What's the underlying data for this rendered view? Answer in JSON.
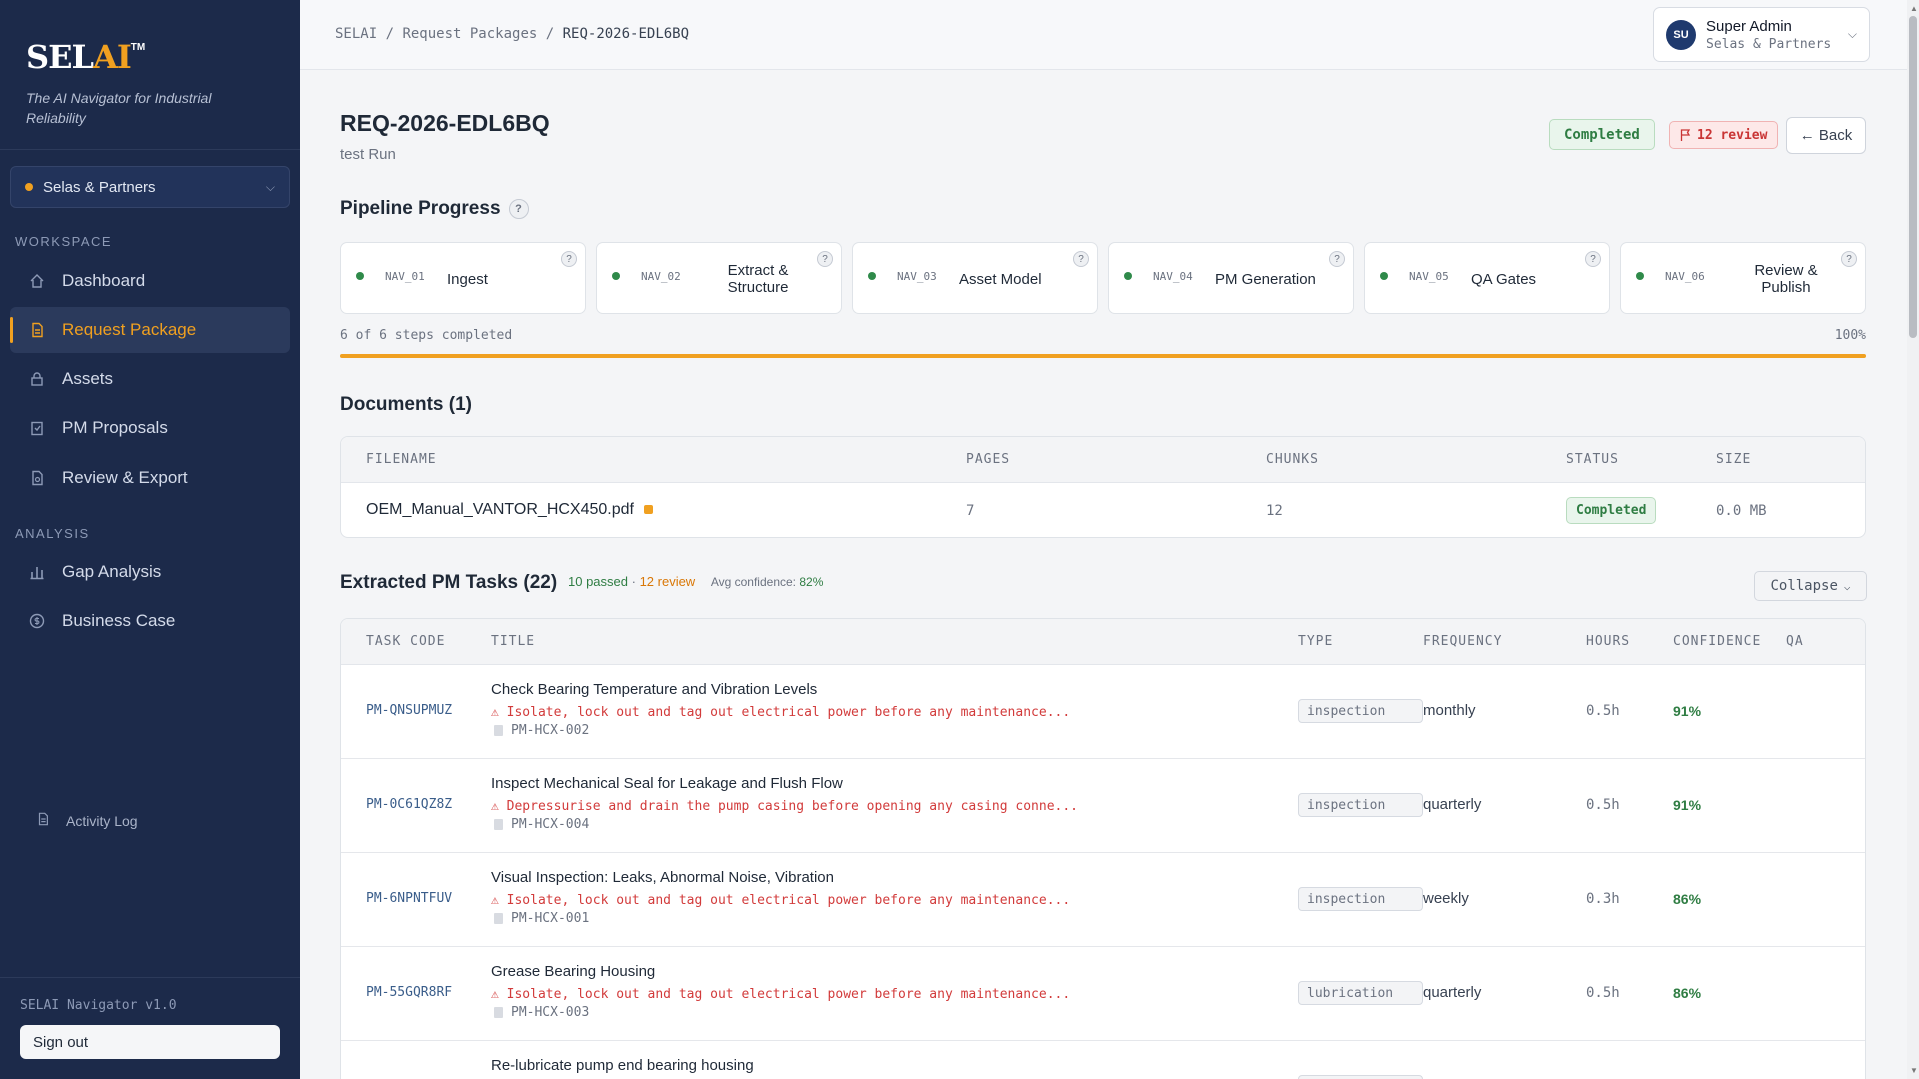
{
  "sidebar": {
    "logo_main": "SEL",
    "logo_accent": "AI",
    "logo_tm": "TM",
    "tagline": "The AI Navigator for Industrial Reliability",
    "org": "Selas & Partners",
    "workspace_label": "WORKSPACE",
    "analysis_label": "ANALYSIS",
    "items": [
      {
        "label": "Dashboard",
        "icon": "home-icon"
      },
      {
        "label": "Request Package",
        "icon": "document-icon"
      },
      {
        "label": "Assets",
        "icon": "lock-icon"
      },
      {
        "label": "PM Proposals",
        "icon": "clipboard-icon"
      },
      {
        "label": "Review & Export",
        "icon": "document-check-icon"
      },
      {
        "label": "Gap Analysis",
        "icon": "bar-chart-icon"
      },
      {
        "label": "Business Case",
        "icon": "dollar-icon"
      }
    ],
    "activity_log": "Activity Log",
    "version": "SELAI Navigator v1.0",
    "sign_out": "Sign out"
  },
  "topbar": {
    "breadcrumb": [
      "SELAI",
      "Request Packages",
      "REQ-2026-EDL6BQ"
    ],
    "user_initials": "SU",
    "user_name": "Super Admin",
    "user_org": "Selas & Partners"
  },
  "header": {
    "title": "REQ-2026-EDL6BQ",
    "subtitle": "test Run",
    "status": "Completed",
    "review_badge": "12 review",
    "back_label": "← Back"
  },
  "pipeline": {
    "title": "Pipeline Progress",
    "steps": [
      {
        "code": "NAV_01",
        "name": "Ingest"
      },
      {
        "code": "NAV_02",
        "name": "Extract & Structure"
      },
      {
        "code": "NAV_03",
        "name": "Asset Model"
      },
      {
        "code": "NAV_04",
        "name": "PM Generation"
      },
      {
        "code": "NAV_05",
        "name": "QA Gates"
      },
      {
        "code": "NAV_06",
        "name": "Review & Publish"
      }
    ],
    "progress_text": "6 of 6 steps completed",
    "progress_pct_label": "100%",
    "progress_fraction": 1.0
  },
  "documents": {
    "title": "Documents (1)",
    "columns": [
      "FILENAME",
      "PAGES",
      "CHUNKS",
      "STATUS",
      "SIZE"
    ],
    "rows": [
      {
        "filename": "OEM_Manual_VANTOR_HCX450.pdf",
        "pages": "7",
        "chunks": "12",
        "status": "Completed",
        "size": "0.0 MB"
      }
    ]
  },
  "tasks": {
    "title": "Extracted PM Tasks (22)",
    "passed": "10 passed",
    "sep": " · ",
    "review": "12 review",
    "avg_label": "Avg confidence: ",
    "avg_value": "82%",
    "collapse_label": "Collapse",
    "columns": [
      "TASK CODE",
      "TITLE",
      "TYPE",
      "FREQUENCY",
      "HOURS",
      "CONFIDENCE",
      "QA"
    ],
    "rows": [
      {
        "code": "PM-QNSUPMUZ",
        "title": "Check Bearing Temperature and Vibration Levels",
        "warning": "⚠ Isolate, lock out and tag out electrical power before any maintenance...",
        "ref": "PM-HCX-002",
        "type": "inspection",
        "frequency": "monthly",
        "hours": "0.5h",
        "confidence": "91%"
      },
      {
        "code": "PM-0C61QZ8Z",
        "title": "Inspect Mechanical Seal for Leakage and Flush Flow",
        "warning": "⚠ Depressurise and drain the pump casing before opening any casing conne...",
        "ref": "PM-HCX-004",
        "type": "inspection",
        "frequency": "quarterly",
        "hours": "0.5h",
        "confidence": "91%"
      },
      {
        "code": "PM-6NPNTFUV",
        "title": "Visual Inspection: Leaks, Abnormal Noise, Vibration",
        "warning": "⚠ Isolate, lock out and tag out electrical power before any maintenance...",
        "ref": "PM-HCX-001",
        "type": "inspection",
        "frequency": "weekly",
        "hours": "0.3h",
        "confidence": "86%"
      },
      {
        "code": "PM-55GQR8RF",
        "title": "Grease Bearing Housing",
        "warning": "⚠ Isolate, lock out and tag out electrical power before any maintenance...",
        "ref": "PM-HCX-003",
        "type": "lubrication",
        "frequency": "quarterly",
        "hours": "0.5h",
        "confidence": "86%"
      },
      {
        "code": "",
        "title": "Re-lubricate pump end bearing housing",
        "warning": "",
        "ref": "",
        "type": "",
        "frequency": "",
        "hours": "",
        "confidence": ""
      }
    ]
  },
  "colors": {
    "sidebar_bg": "#1c2a4a",
    "accent": "#f0a020",
    "success": "#2f7d43",
    "danger": "#d23b3b"
  }
}
